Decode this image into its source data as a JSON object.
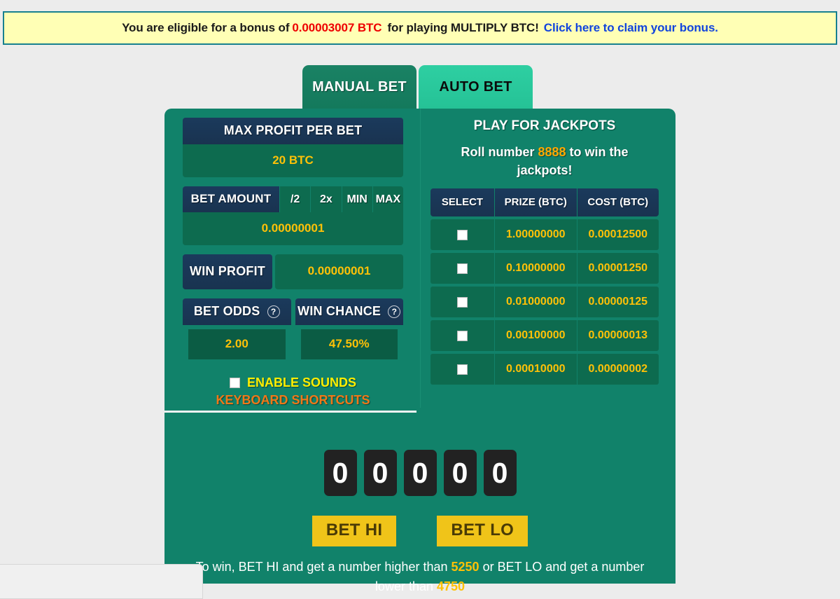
{
  "banner": {
    "prefix": "You are eligible for a bonus of",
    "amount": "0.00003007 BTC",
    "middle": "for playing MULTIPLY BTC!",
    "link": "Click here to claim your bonus.",
    "bg_color": "#ffffb5",
    "border_color": "#17808f",
    "amount_color": "#ee0000",
    "link_color": "#1144dd"
  },
  "tabs": [
    {
      "label": "MANUAL BET",
      "active": false
    },
    {
      "label": "AUTO BET",
      "active": true
    }
  ],
  "left_panel": {
    "max_profit": {
      "label": "MAX PROFIT PER BET",
      "value": "20 BTC"
    },
    "bet_amount": {
      "label": "BET AMOUNT",
      "buttons": [
        "/2",
        "2x",
        "MIN",
        "MAX"
      ],
      "value": "0.00000001"
    },
    "win_profit": {
      "label": "WIN PROFIT",
      "value": "0.00000001"
    },
    "bet_odds": {
      "label": "BET ODDS",
      "help": "?",
      "value": "2.00"
    },
    "win_chance": {
      "label": "WIN CHANCE",
      "help": "?",
      "value": "47.50%"
    },
    "enable_sounds": {
      "label": "ENABLE SOUNDS",
      "checked": false
    },
    "keyboard_shortcuts": {
      "label": "KEYBOARD SHORTCUTS"
    }
  },
  "right_panel": {
    "title": "PLAY FOR JACKPOTS",
    "subtitle_pre": "Roll number",
    "roll_number": "8888",
    "subtitle_post": "to win the jackpots!",
    "columns": [
      "SELECT",
      "PRIZE (BTC)",
      "COST (BTC)"
    ],
    "rows": [
      {
        "selected": false,
        "prize": "1.00000000",
        "cost": "0.00012500"
      },
      {
        "selected": false,
        "prize": "0.10000000",
        "cost": "0.00001250"
      },
      {
        "selected": false,
        "prize": "0.01000000",
        "cost": "0.00000125"
      },
      {
        "selected": false,
        "prize": "0.00100000",
        "cost": "0.00000013"
      },
      {
        "selected": false,
        "prize": "0.00010000",
        "cost": "0.00000002"
      }
    ]
  },
  "roll_display": {
    "digits": [
      "0",
      "0",
      "0",
      "0",
      "0"
    ]
  },
  "bet_actions": {
    "bet_hi": "BET HI",
    "bet_lo": "BET LO"
  },
  "win_rule": {
    "part1": "To win, BET HI and get a number higher than",
    "hi_number": "5250",
    "part2": "or BET LO and get a number lower than",
    "lo_number": "4750"
  },
  "theme": {
    "page_bg": "#ececec",
    "panel_green": "#11826a",
    "value_green": "#0d6b4f",
    "label_navy": "#1b3a5c",
    "gold": "#ffc107",
    "tab_active": "#2ecfa2",
    "bet_button": "#f0c419"
  }
}
